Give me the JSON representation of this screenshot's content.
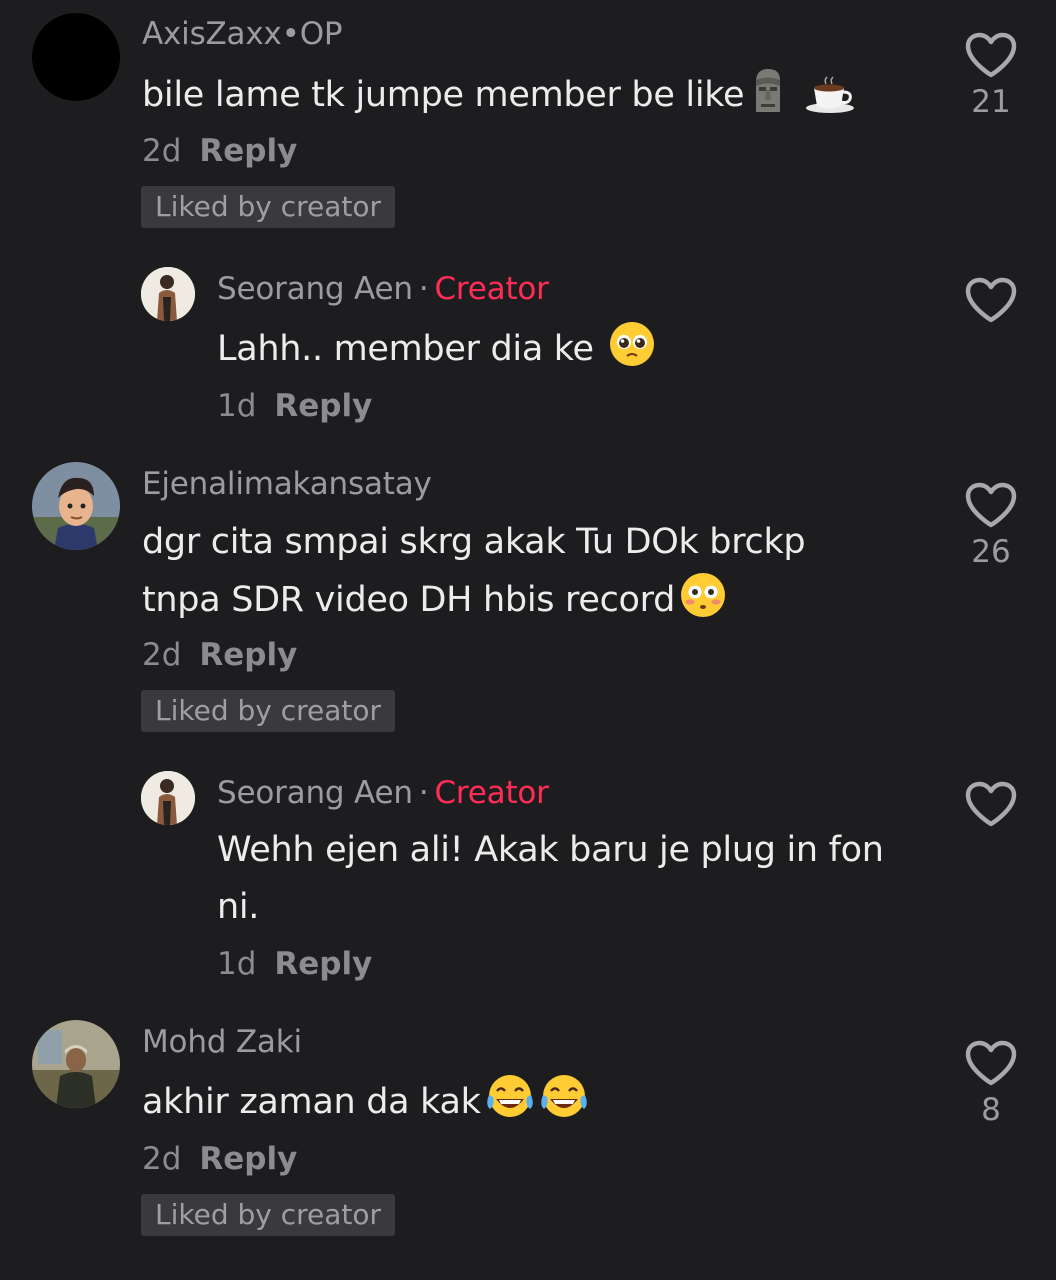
{
  "comments": [
    {
      "username": "AxisZaxx•OP",
      "text": "bile lame tk jumpe member be like",
      "emojis": [
        "moai-emoji",
        "coffee-emoji"
      ],
      "time": "2d",
      "reply_label": "Reply",
      "liked_label": "Liked by creator",
      "likes": "21"
    },
    {
      "username": "Seorang Aen",
      "separator": "·",
      "creator_label": "Creator",
      "text": "Lahh.. member dia ke",
      "emojis": [
        "pleading-face-emoji"
      ],
      "time": "1d",
      "reply_label": "Reply"
    },
    {
      "username": "Ejenalimakansatay",
      "text": "dgr cita smpai skrg akak Tu DOk brckp tnpa SDR video DH hbis record",
      "emojis": [
        "flushed-face-emoji"
      ],
      "time": "2d",
      "reply_label": "Reply",
      "liked_label": "Liked by creator",
      "likes": "26"
    },
    {
      "username": "Seorang Aen",
      "separator": "·",
      "creator_label": "Creator",
      "text": "Wehh ejen ali! Akak baru je plug in fon ni.",
      "time": "1d",
      "reply_label": "Reply"
    },
    {
      "username": "Mohd Zaki",
      "text": "akhir zaman da kak",
      "emojis": [
        "tears-of-joy-emoji",
        "tears-of-joy-emoji"
      ],
      "time": "2d",
      "reply_label": "Reply",
      "liked_label": "Liked by creator",
      "likes": "8"
    }
  ],
  "icons": {
    "like": "heart-outline-icon"
  },
  "colors": {
    "background": "#1d1d1f",
    "creator_accent": "#ff2c55",
    "badge_bg": "#3a3a3c"
  }
}
